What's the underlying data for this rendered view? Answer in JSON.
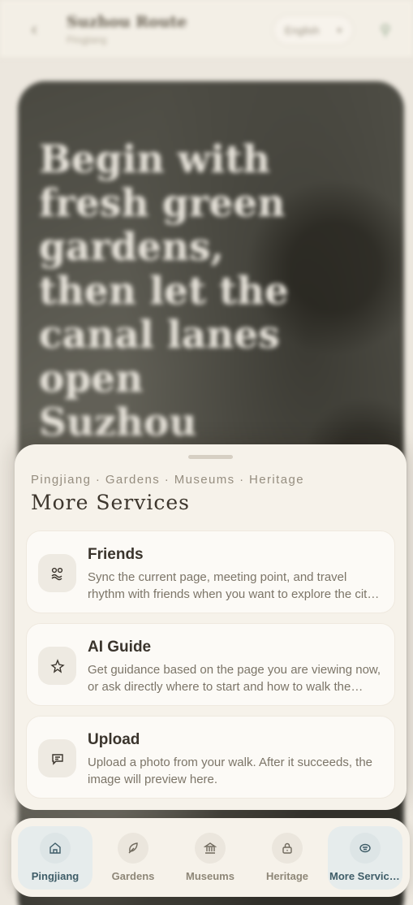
{
  "header": {
    "title": "Suzhou Route",
    "subtitle": "Pingjiang",
    "language": "English"
  },
  "hero": {
    "title": "Begin with fresh green gardens, then let the canal lanes open Suzhou"
  },
  "sheet": {
    "breadcrumb": "Pingjiang · Gardens · Museums · Heritage",
    "title": "More Services",
    "cards": [
      {
        "title": "Friends",
        "description": "Sync the current page, meeting point, and travel rhythm with friends when you want to explore the city together.",
        "icon": "friends-icon"
      },
      {
        "title": "AI Guide",
        "description": "Get guidance based on the page you are viewing now, or ask directly where to start and how to walk the route.",
        "icon": "sparkle-icon"
      },
      {
        "title": "Upload",
        "description": "Upload a photo from your walk. After it succeeds, the image will preview here.",
        "icon": "message-icon"
      }
    ]
  },
  "nav": {
    "items": [
      {
        "label": "Pingjiang",
        "icon": "home-icon",
        "active": true
      },
      {
        "label": "Gardens",
        "icon": "leaf-icon",
        "active": false
      },
      {
        "label": "Museums",
        "icon": "museum-icon",
        "active": false
      },
      {
        "label": "Heritage",
        "icon": "lock-icon",
        "active": false
      },
      {
        "label": "More Services",
        "icon": "services-icon",
        "active": true
      }
    ]
  },
  "colors": {
    "accent": "#3f5d68",
    "sheet": "#f6f2ea",
    "active_nav": "#e6ecec"
  }
}
